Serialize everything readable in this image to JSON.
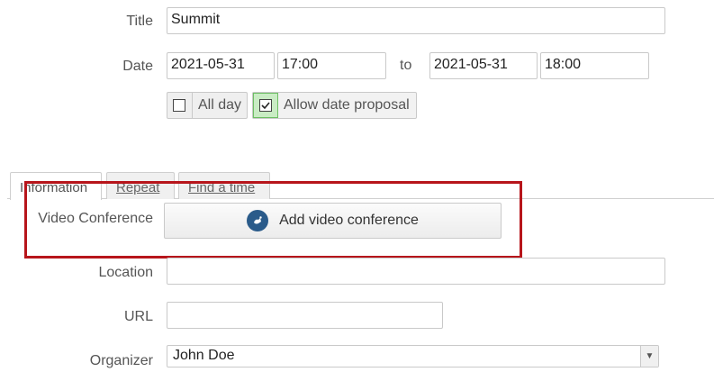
{
  "form": {
    "title_label": "Title",
    "title_value": "Summit",
    "date_label": "Date",
    "start_date": "2021-05-31",
    "start_time": "17:00",
    "to_label": "to",
    "end_date": "2021-05-31",
    "end_time": "18:00",
    "all_day_label": "All day",
    "all_day_checked": false,
    "allow_proposal_label": "Allow date proposal",
    "allow_proposal_checked": true
  },
  "tabs": [
    {
      "label": "Information",
      "active": true
    },
    {
      "label": "Repeat",
      "active": false
    },
    {
      "label": "Find a time",
      "active": false
    }
  ],
  "info": {
    "video_conference_label": "Video Conference",
    "add_video_conference_label": "Add video conference",
    "location_label": "Location",
    "location_value": "",
    "url_label": "URL",
    "url_value": "",
    "organizer_label": "Organizer",
    "organizer_value": "John Doe"
  },
  "colors": {
    "highlight_border": "#b7151b",
    "checked_bg": "#c9ecc4",
    "video_icon_bg": "#2a5b8a"
  },
  "icons": {
    "checkbox_checked": "check-icon",
    "video_conference": "video-conference-icon",
    "dropdown": "chevron-down-icon"
  }
}
